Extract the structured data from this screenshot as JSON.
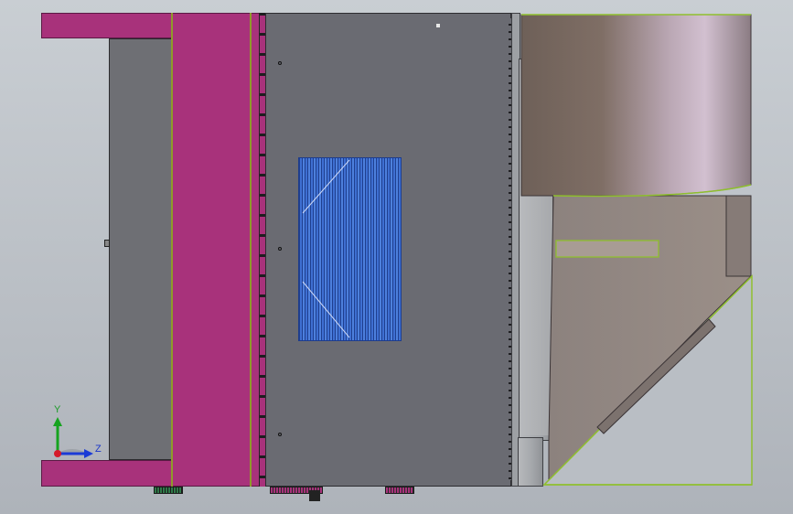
{
  "triad": {
    "y_label": "Y",
    "z_label": "Z"
  },
  "colors": {
    "frame": "#a8327b",
    "panel": "#6a6b72",
    "vent": "#3e6fd2",
    "edge_highlight": "#8fbf2e",
    "tank_top": "#c9b3c4",
    "tank_body": "#948a83"
  }
}
